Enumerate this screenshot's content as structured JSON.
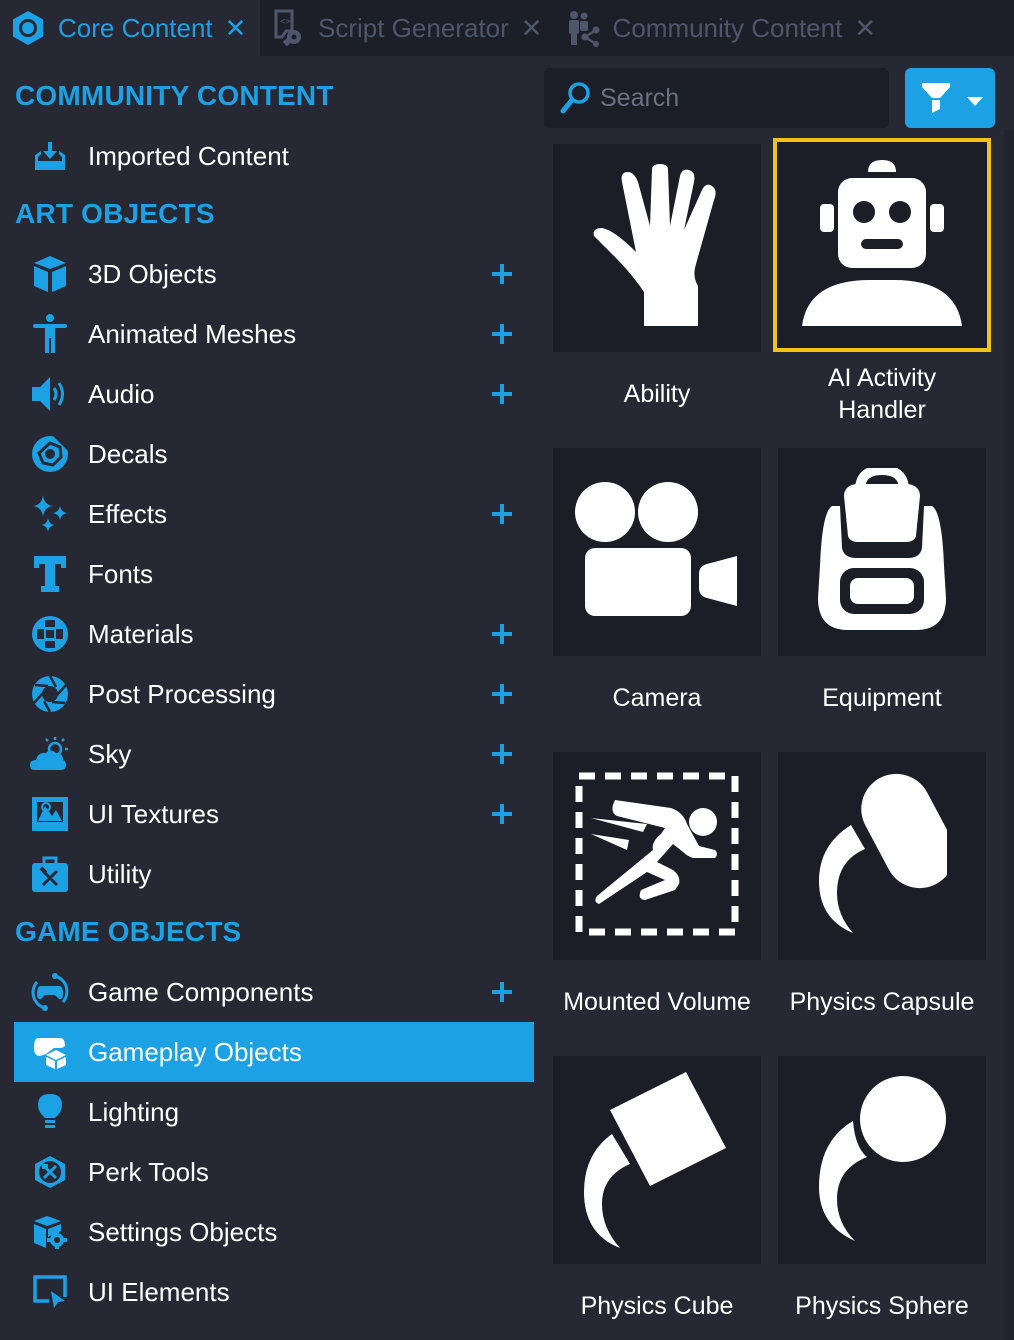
{
  "tabs": [
    {
      "label": "Core Content",
      "icon": "core-content-icon",
      "active": true
    },
    {
      "label": "Script Generator",
      "icon": "script-generator-icon",
      "active": false
    },
    {
      "label": "Community Content",
      "icon": "community-content-icon",
      "active": false
    }
  ],
  "tab_close_glyph": "✕",
  "sidebar": {
    "sections": [
      {
        "title": "COMMUNITY CONTENT"
      },
      {
        "title": "ART OBJECTS"
      },
      {
        "title": "GAME OBJECTS"
      }
    ],
    "items": [
      {
        "label": "Imported Content",
        "icon": "import-icon",
        "addable": false
      },
      {
        "label": "3D Objects",
        "icon": "cube-icon",
        "addable": true
      },
      {
        "label": "Animated Meshes",
        "icon": "person-icon",
        "addable": true
      },
      {
        "label": "Audio",
        "icon": "speaker-icon",
        "addable": true
      },
      {
        "label": "Decals",
        "icon": "decal-icon",
        "addable": false
      },
      {
        "label": "Effects",
        "icon": "sparkles-icon",
        "addable": true
      },
      {
        "label": "Fonts",
        "icon": "font-icon",
        "addable": false
      },
      {
        "label": "Materials",
        "icon": "materials-icon",
        "addable": true
      },
      {
        "label": "Post Processing",
        "icon": "aperture-icon",
        "addable": true
      },
      {
        "label": "Sky",
        "icon": "sky-icon",
        "addable": true
      },
      {
        "label": "UI Textures",
        "icon": "image-icon",
        "addable": true
      },
      {
        "label": "Utility",
        "icon": "toolbox-icon",
        "addable": false
      },
      {
        "label": "Game Components",
        "icon": "game-components-icon",
        "addable": true
      },
      {
        "label": "Gameplay Objects",
        "icon": "gameplay-objects-icon",
        "addable": false,
        "selected": true
      },
      {
        "label": "Lighting",
        "icon": "lightbulb-icon",
        "addable": false
      },
      {
        "label": "Perk Tools",
        "icon": "perk-tools-icon",
        "addable": false
      },
      {
        "label": "Settings Objects",
        "icon": "settings-cube-icon",
        "addable": false
      },
      {
        "label": "UI Elements",
        "icon": "ui-elements-icon",
        "addable": false
      }
    ],
    "add_glyph": "+"
  },
  "search": {
    "placeholder": "Search",
    "value": ""
  },
  "filter": {
    "icon": "filter-icon",
    "dropdown_icon": "caret-down-icon"
  },
  "tiles": [
    {
      "label": "Ability",
      "icon": "hand-icon"
    },
    {
      "label": "AI Activity Handler",
      "label_line1": "AI Activity",
      "label_line2": "Handler",
      "icon": "robot-icon",
      "selected": true
    },
    {
      "label": "Camera",
      "icon": "movie-camera-icon"
    },
    {
      "label": "Equipment",
      "icon": "backpack-icon"
    },
    {
      "label": "Mounted Volume",
      "icon": "running-volume-icon"
    },
    {
      "label": "Physics Capsule",
      "icon": "physics-capsule-icon"
    },
    {
      "label": "Physics Cube",
      "icon": "physics-cube-icon"
    },
    {
      "label": "Physics Sphere",
      "icon": "physics-sphere-icon"
    }
  ],
  "colors": {
    "accent": "#1ba1e4",
    "selection_border": "#f5c018",
    "panel_bg": "#262833",
    "tile_bg": "#1b1e26",
    "inactive_tab_text": "#4e566b"
  }
}
